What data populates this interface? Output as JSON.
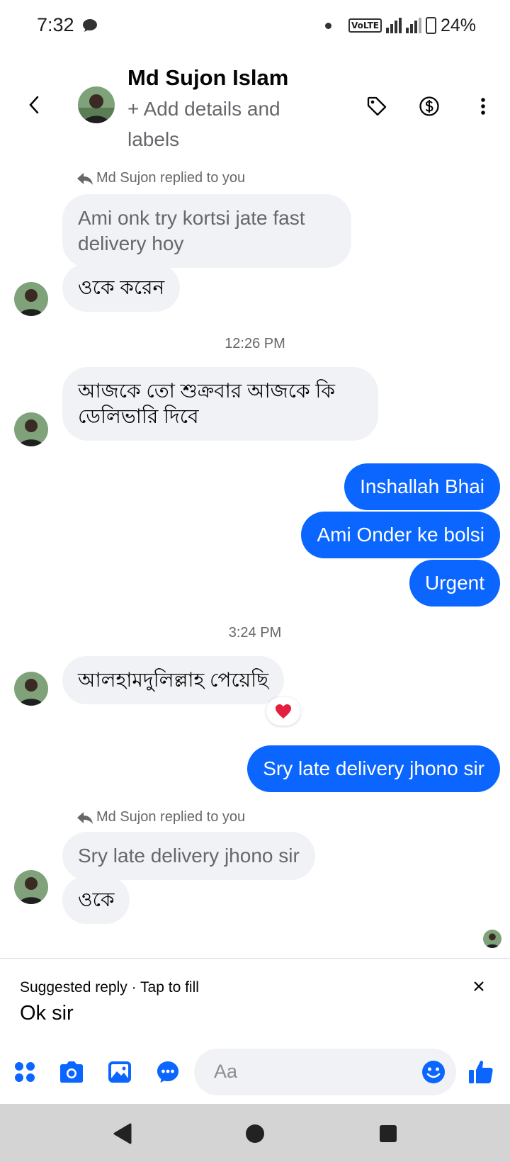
{
  "status_bar": {
    "time": "7:32",
    "network_badge": "VoLTE",
    "battery": "24%"
  },
  "header": {
    "contact_name": "Md Sujon Islam",
    "subtitle": "+ Add details and labels",
    "icons": [
      "back-icon",
      "tag-icon",
      "dollar-icon",
      "more-icon"
    ]
  },
  "messages": {
    "reply1_label": "Md Sujon replied to you",
    "reply1_quoted": "Ami onk try kortsi jate fast delivery hoy",
    "reply1_text": "ওকে করেন",
    "time1": "12:26 PM",
    "msg2": "আজকে তো শুক্রবার আজকে কি ডেলিভারি দিবে",
    "out1": "Inshallah Bhai",
    "out2": "Ami Onder ke bolsi",
    "out3": "Urgent",
    "time2": "3:24 PM",
    "msg3": "আলহামদুলিল্লাহ পেয়েছি",
    "msg3_reaction": "heart",
    "out4": "Sry late delivery jhono sir",
    "reply2_label": "Md Sujon replied to you",
    "reply2_quoted": "Sry late delivery jhono sir",
    "reply2_text": "ওকে"
  },
  "suggested": {
    "label": "Suggested reply · Tap to fill",
    "text": "Ok sir"
  },
  "composer": {
    "placeholder": "Aa"
  },
  "colors": {
    "accent": "#0a66ff",
    "incoming_bubble": "#f0f2f5",
    "reaction": "#e41e3f"
  }
}
